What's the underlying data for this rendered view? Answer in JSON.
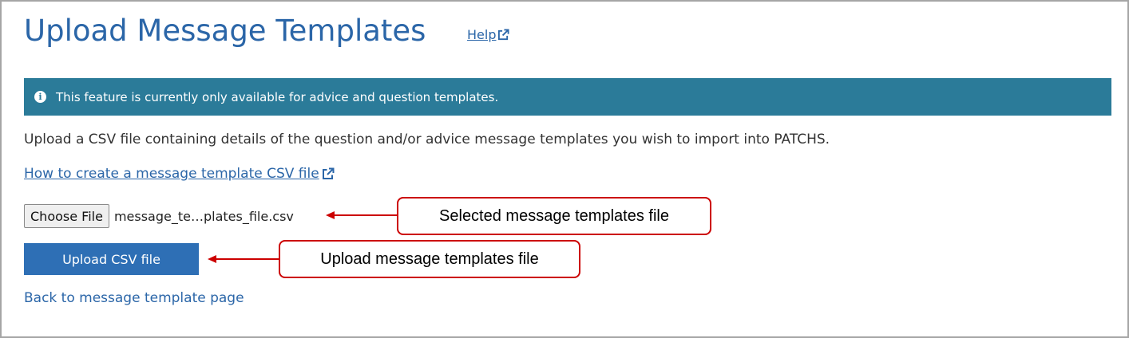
{
  "page": {
    "title": "Upload Message Templates",
    "help_label": "Help"
  },
  "alert": {
    "text": "This feature is currently only available for advice and question templates."
  },
  "intro_text": "Upload a CSV file containing details of the question and/or advice message templates you wish to import into PATCHS.",
  "howto_link": "How to create a message template CSV file",
  "file_input": {
    "button_label": "Choose File",
    "selected_file": "message_te…plates_file.csv"
  },
  "upload_button_label": "Upload CSV file",
  "back_link": "Back to message template page",
  "annotations": {
    "selected_file": "Selected message templates file",
    "upload_file": "Upload message templates file"
  },
  "colors": {
    "title_blue": "#2b66a8",
    "alert_teal": "#2b7b99",
    "button_blue": "#2e6fb5",
    "callout_red": "#cc0000"
  },
  "icons": {
    "help": "external-link-icon",
    "howto": "external-link-icon",
    "alert": "info-icon"
  }
}
